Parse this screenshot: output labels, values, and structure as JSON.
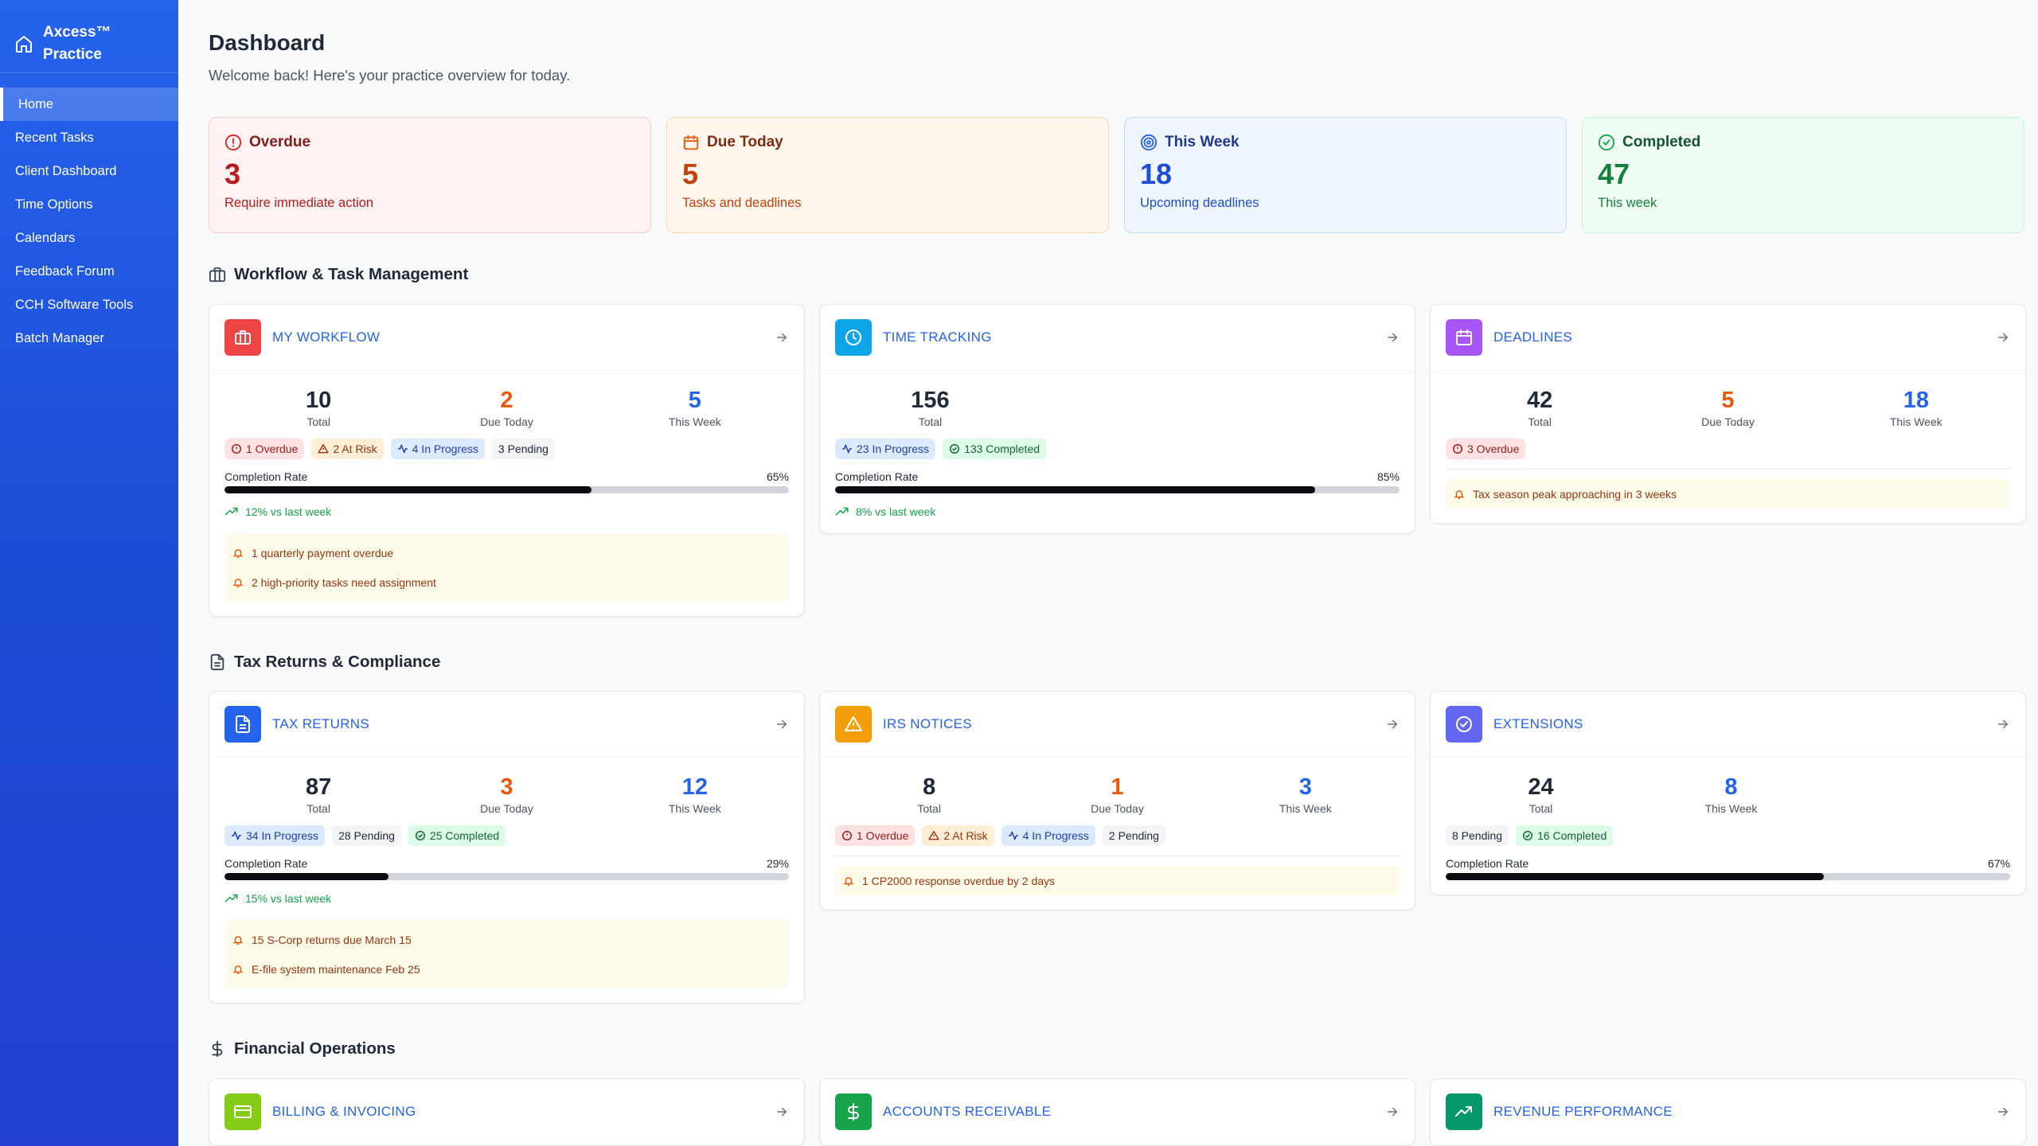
{
  "app": {
    "name_line1": "Axcess™",
    "name_line2": "Practice"
  },
  "sidebar": {
    "items": [
      {
        "label": "Home"
      },
      {
        "label": "Recent Tasks"
      },
      {
        "label": "Client Dashboard"
      },
      {
        "label": "Time Options"
      },
      {
        "label": "Calendars"
      },
      {
        "label": "Feedback Forum"
      },
      {
        "label": "CCH Software Tools"
      },
      {
        "label": "Batch Manager"
      }
    ]
  },
  "header": {
    "title": "Dashboard",
    "subtitle": "Welcome back! Here's your practice overview for today."
  },
  "stats": {
    "overdue": {
      "label": "Overdue",
      "value": "3",
      "desc": "Require immediate action"
    },
    "due_today": {
      "label": "Due Today",
      "value": "5",
      "desc": "Tasks and deadlines"
    },
    "this_week": {
      "label": "This Week",
      "value": "18",
      "desc": "Upcoming deadlines"
    },
    "completed": {
      "label": "Completed",
      "value": "47",
      "desc": "This week"
    }
  },
  "sections": {
    "workflow": "Workflow & Task Management",
    "tax": "Tax Returns & Compliance",
    "financial": "Financial Operations"
  },
  "labels": {
    "total": "Total",
    "due_today": "Due Today",
    "this_week": "This Week",
    "completion_rate": "Completion Rate"
  },
  "cards": {
    "my_workflow": {
      "title": "MY WORKFLOW",
      "total": "10",
      "due_today": "2",
      "this_week": "5",
      "badges": {
        "overdue": "1 Overdue",
        "at_risk": "2 At Risk",
        "in_progress": "4 In Progress",
        "pending": "3 Pending"
      },
      "rate": "65%",
      "rate_value": 0.65,
      "trend": "12% vs last week",
      "alerts": [
        "1 quarterly payment overdue",
        "2 high-priority tasks need assignment"
      ]
    },
    "time_tracking": {
      "title": "TIME TRACKING",
      "total": "156",
      "badges": {
        "in_progress": "23 In Progress",
        "completed": "133 Completed"
      },
      "rate": "85%",
      "rate_value": 0.85,
      "trend": "8% vs last week"
    },
    "deadlines": {
      "title": "DEADLINES",
      "total": "42",
      "due_today": "5",
      "this_week": "18",
      "badges": {
        "overdue": "3 Overdue"
      },
      "alerts": [
        "Tax season peak approaching in 3 weeks"
      ]
    },
    "tax_returns": {
      "title": "TAX RETURNS",
      "total": "87",
      "due_today": "3",
      "this_week": "12",
      "badges": {
        "in_progress": "34 In Progress",
        "pending": "28 Pending",
        "completed": "25 Completed"
      },
      "rate": "29%",
      "rate_value": 0.29,
      "trend": "15% vs last week",
      "alerts": [
        "15 S-Corp returns due March 15",
        "E-file system maintenance Feb 25"
      ]
    },
    "irs_notices": {
      "title": "IRS NOTICES",
      "total": "8",
      "due_today": "1",
      "this_week": "3",
      "badges": {
        "overdue": "1 Overdue",
        "at_risk": "2 At Risk",
        "in_progress": "4 In Progress",
        "pending": "2 Pending"
      },
      "alerts": [
        "1 CP2000 response overdue by 2 days"
      ]
    },
    "extensions": {
      "title": "EXTENSIONS",
      "total": "24",
      "this_week": "8",
      "badges": {
        "pending": "8 Pending",
        "completed": "16 Completed"
      },
      "rate": "67%",
      "rate_value": 0.67
    },
    "billing": {
      "title": "BILLING & INVOICING"
    },
    "receivable": {
      "title": "ACCOUNTS RECEIVABLE"
    },
    "revenue": {
      "title": "REVENUE PERFORMANCE"
    }
  },
  "colors": {
    "sidebar": "#2563eb",
    "workflow_icon": "#ef4444",
    "time_icon": "#0ea5e9",
    "deadlines_icon": "#a855f7",
    "tax_icon": "#2563eb",
    "irs_icon": "#f59e0b",
    "extensions_icon": "#6366f1",
    "billing_icon": "#84cc16",
    "receivable_icon": "#16a34a",
    "revenue_icon": "#059669"
  }
}
